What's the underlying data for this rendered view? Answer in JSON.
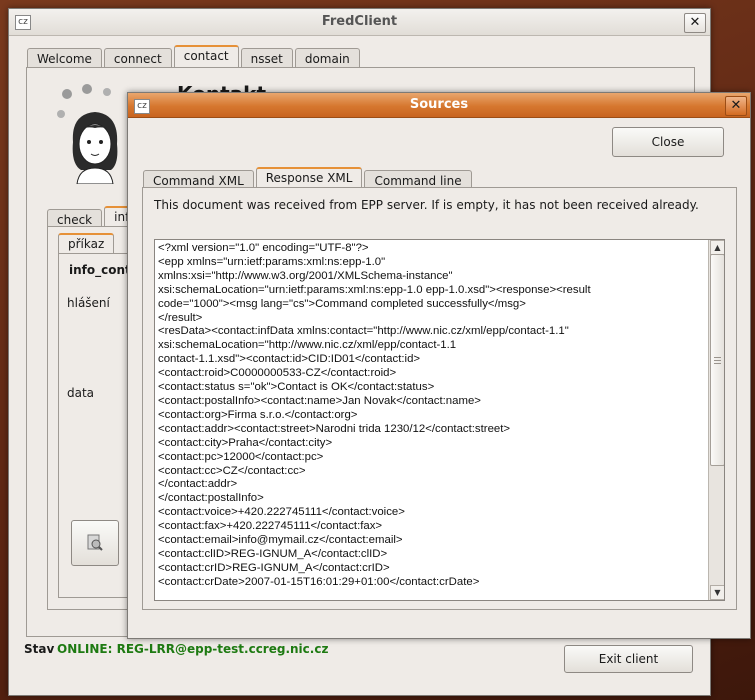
{
  "main_window": {
    "title": "FredClient",
    "icon_text": "cz",
    "tabs": [
      "Welcome",
      "connect",
      "contact",
      "nsset",
      "domain"
    ],
    "active_tab": "contact",
    "heading_partial": "Kontakt",
    "inner_tabs": [
      "check",
      "inf"
    ],
    "sub_tab": "příkaz",
    "command_name": "info_conta",
    "row_labels": {
      "report": "hlášení",
      "data": "data"
    },
    "status_label": "Stav",
    "status_value": "ONLINE: REG-LRR@epp-test.ccreg.nic.cz",
    "status_color": "#1e7a12",
    "exit_button": "Exit client"
  },
  "sources_dialog": {
    "title": "Sources",
    "icon_text": "cz",
    "close_button": "Close",
    "tabs": [
      "Command XML",
      "Response XML",
      "Command line"
    ],
    "active_tab": "Response XML",
    "info_text": "This document was received from EPP server. If is empty, it has not been received already.",
    "xml_lines": [
      "<?xml version=\"1.0\" encoding=\"UTF-8\"?>",
      "<epp xmlns=\"urn:ietf:params:xml:ns:epp-1.0\"",
      "xmlns:xsi=\"http://www.w3.org/2001/XMLSchema-instance\"",
      "xsi:schemaLocation=\"urn:ietf:params:xml:ns:epp-1.0 epp-1.0.xsd\"><response><result",
      "code=\"1000\"><msg lang=\"cs\">Command completed successfully</msg>",
      "</result>",
      "<resData><contact:infData xmlns:contact=\"http://www.nic.cz/xml/epp/contact-1.1\"",
      "xsi:schemaLocation=\"http://www.nic.cz/xml/epp/contact-1.1",
      "contact-1.1.xsd\"><contact:id>CID:ID01</contact:id>",
      "<contact:roid>C0000000533-CZ</contact:roid>",
      "<contact:status s=\"ok\">Contact is OK</contact:status>",
      "<contact:postalInfo><contact:name>Jan Novak</contact:name>",
      "<contact:org>Firma s.r.o.</contact:org>",
      "<contact:addr><contact:street>Narodni trida 1230/12</contact:street>",
      "<contact:city>Praha</contact:city>",
      "<contact:pc>12000</contact:pc>",
      "<contact:cc>CZ</contact:cc>",
      "</contact:addr>",
      "</contact:postalInfo>",
      "<contact:voice>+420.222745111</contact:voice>",
      "<contact:fax>+420.222745111</contact:fax>",
      "<contact:email>info@mymail.cz</contact:email>",
      "<contact:clID>REG-IGNUM_A</contact:clID>",
      "<contact:crID>REG-IGNUM_A</contact:crID>",
      "<contact:crDate>2007-01-15T16:01:29+01:00</contact:crDate>"
    ]
  }
}
